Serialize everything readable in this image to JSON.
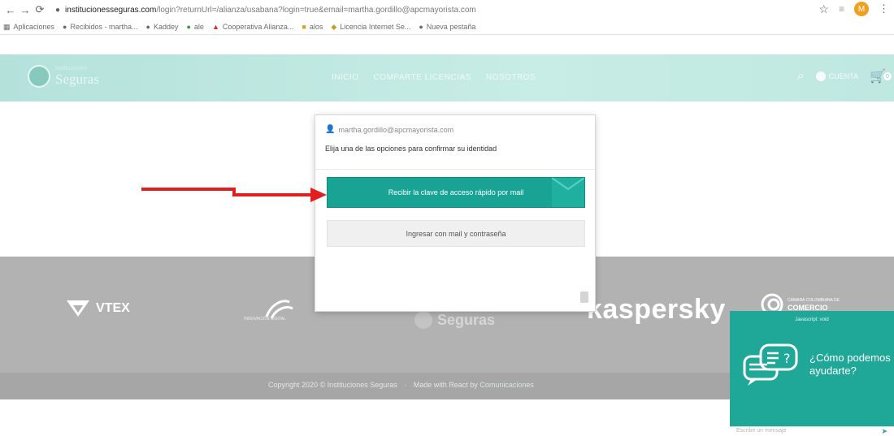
{
  "browser": {
    "url_host": "institucionesseguras.com",
    "url_path": "/login?returnUrl=/alianza/usabana?login=true&email=martha.gordillo@apcmayorista.com",
    "bookmarks": [
      "Aplicaciones",
      "Recibidos - martha...",
      "Kaddey",
      "ale",
      "Cooperativa Alianza...",
      "alos",
      "Licencia Internet Se...",
      "Nueva pestaña"
    ],
    "profile_initial": "M"
  },
  "header": {
    "logo_small": "Instituciones",
    "logo_name": "Seguras",
    "nav": [
      "INICIO",
      "COMPARTE LICENCIAS",
      "NOSOTROS"
    ],
    "user_label": "CUENTA",
    "cart_count": "0"
  },
  "modal": {
    "email": "martha.gordillo@apcmayorista.com",
    "instruction": "Elija una de las opciones para confirmar su identidad",
    "primary_button": "Recibir la clave de acceso rápido por mail",
    "secondary_button": "Ingresar con mail y contraseña"
  },
  "partners": {
    "vtex": "VTEX",
    "swirl_caption": "INNOVACIÓN DIGITAL",
    "seguras": "Seguras",
    "kaspersky": "kaspersky",
    "camara_small": "CÁMARA COLOMBIANA DE",
    "camara_big": "COMERCIO"
  },
  "footer": {
    "copyright": "Copyright 2020 © Instituciones Seguras",
    "made_with": "Made with React by",
    "made_by": "Comunicaciones"
  },
  "chat": {
    "header": "Javascript: void",
    "message": "¿Cómo podemos ayudarte?",
    "input_placeholder": "Escribe un mensaje"
  },
  "colors": {
    "teal": "#18a394",
    "header_teal": "#b4e2db",
    "arrow_red": "#e31e1e",
    "footer_gray": "#b2b2b2"
  }
}
